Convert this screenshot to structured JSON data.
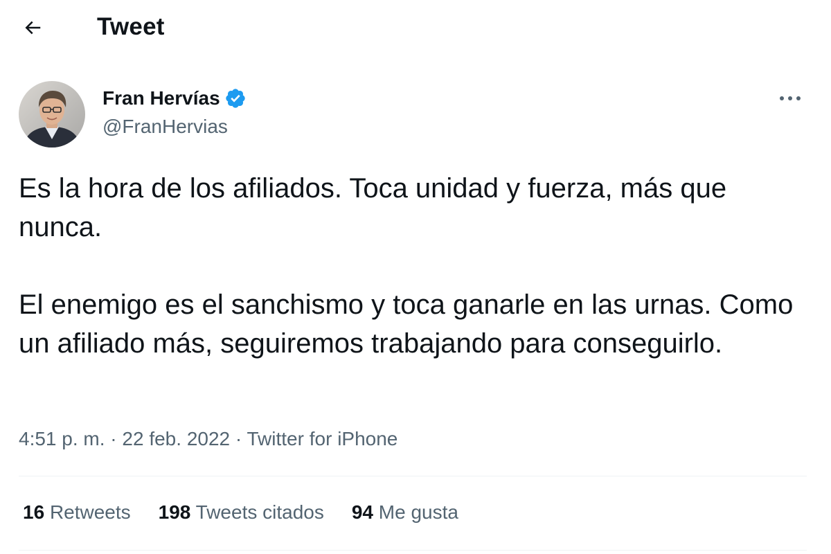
{
  "header": {
    "title": "Tweet"
  },
  "author": {
    "name": "Fran Hervías",
    "handle": "@FranHervias",
    "verified": true
  },
  "tweet": {
    "paragraphs": [
      "Es la hora de los afiliados. Toca unidad y fuerza, más que nunca.",
      "El enemigo es el sanchismo y toca ganarle en las urnas. Como un afiliado más, seguiremos trabajando para conseguirlo."
    ],
    "time": "4:51 p. m.",
    "separator": "·",
    "date": "22 feb. 2022",
    "source": "Twitter for iPhone"
  },
  "stats": [
    {
      "count": "16",
      "label": "Retweets"
    },
    {
      "count": "198",
      "label": "Tweets citados"
    },
    {
      "count": "94",
      "label": "Me gusta"
    }
  ],
  "icons": {
    "back": "arrow-left-icon",
    "verified": "verified-badge-icon",
    "more": "more-dots-icon"
  },
  "colors": {
    "text_primary": "#0f1419",
    "text_secondary": "#536471",
    "verified_blue": "#1d9bf0",
    "divider": "#eff3f4"
  }
}
